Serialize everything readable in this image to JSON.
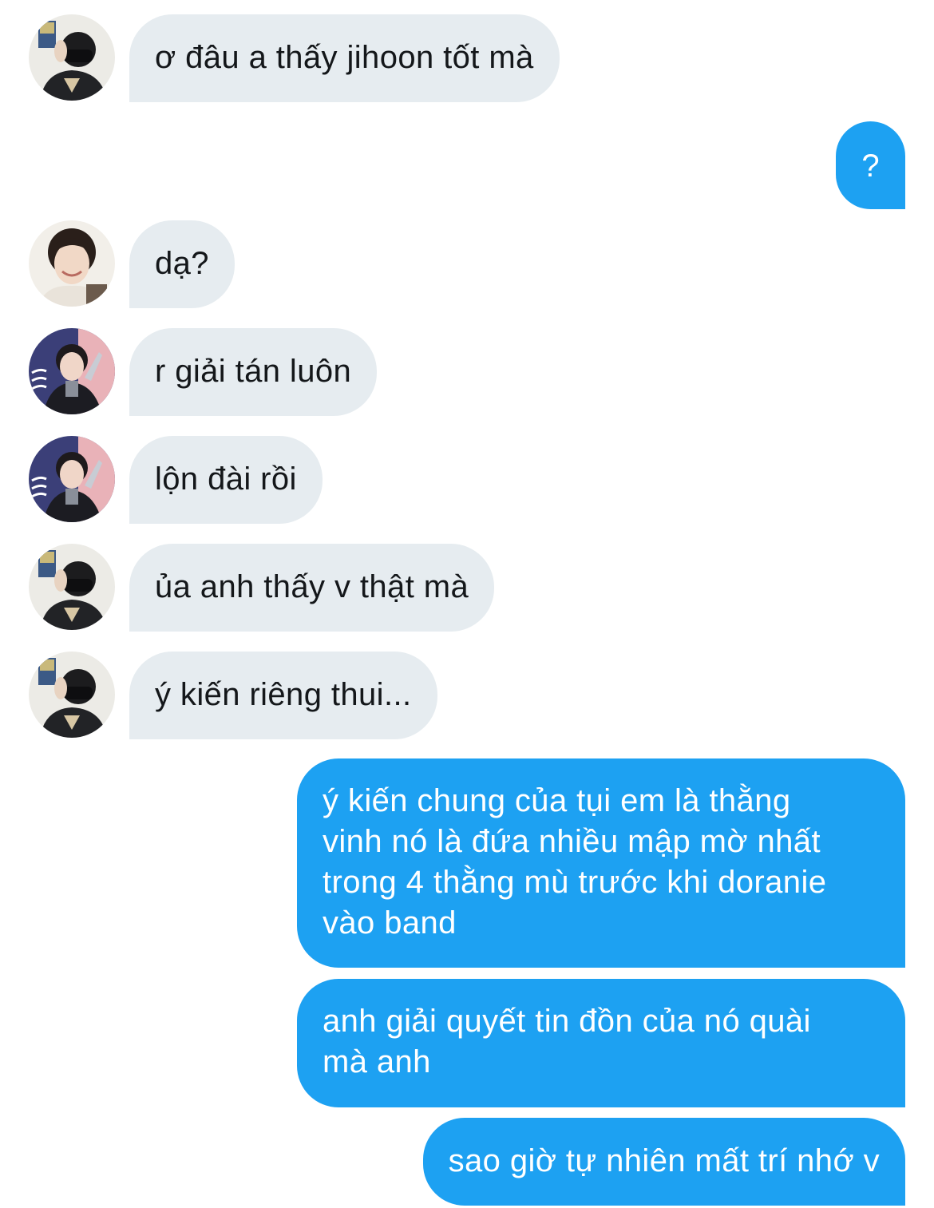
{
  "conversation": {
    "messages": [
      {
        "id": "m1",
        "side": "received",
        "avatar": "avatar-masked-person",
        "text": "ơ đâu a thấy jihoon tốt mà"
      },
      {
        "id": "m2",
        "side": "sent",
        "text": "?"
      },
      {
        "id": "m3",
        "side": "received",
        "avatar": "avatar-smiling-person",
        "text": "dạ?"
      },
      {
        "id": "m4",
        "side": "received",
        "avatar": "avatar-trophy-person",
        "text": "r giải tán luôn"
      },
      {
        "id": "m5",
        "side": "received",
        "avatar": "avatar-trophy-person",
        "text": "lộn đài rồi"
      },
      {
        "id": "m6",
        "side": "received",
        "avatar": "avatar-masked-person",
        "text": "ủa anh thấy v thật mà"
      },
      {
        "id": "m7",
        "side": "received",
        "avatar": "avatar-masked-person",
        "text": "ý kiến riêng thui..."
      },
      {
        "id": "m8",
        "side": "sent",
        "lines": [
          "ý kiến chung của tụi em là thằng",
          "vinh nó là đứa nhiều mập mờ nhất",
          "trong 4 thằng mù trước khi doranie",
          "vào band"
        ]
      },
      {
        "id": "m9",
        "side": "sent",
        "lines": [
          "anh giải quyết tin đồn của nó quài",
          "mà anh"
        ]
      },
      {
        "id": "m10",
        "side": "sent",
        "text": "sao giờ tự nhiên mất trí nhớ v"
      }
    ]
  },
  "colors": {
    "received_bubble": "#e6ecf0",
    "sent_bubble": "#1da1f2",
    "received_text": "#14171a",
    "sent_text": "#ffffff"
  }
}
